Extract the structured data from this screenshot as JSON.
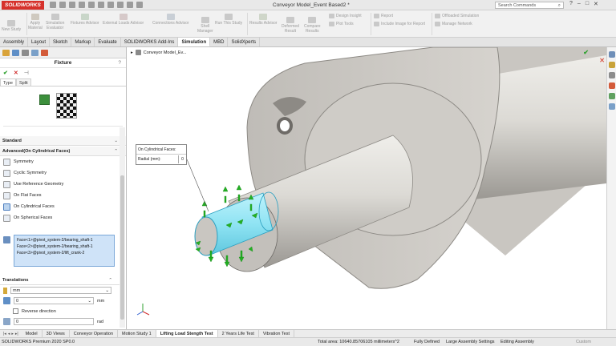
{
  "app": {
    "logo_text": "SOLIDWORKS",
    "doc_title": "Conveyor Model_Event Based2 *"
  },
  "search": {
    "placeholder": "Search Commands"
  },
  "window_controls": [
    "?",
    "–",
    "□",
    "✕"
  ],
  "commands": {
    "new_study": "New Study",
    "apply_material": [
      "Apply",
      "Material"
    ],
    "simulation_evaluator": [
      "Simulation",
      "Evaluator"
    ],
    "fixtures_advisor": "Fixtures Advisor",
    "external_loads_advisor": "External Loads Advisor",
    "connections_advisor": "Connections Advisor",
    "shell_manager": [
      "Shell",
      "Manager"
    ],
    "run_this_study": "Run This Study",
    "results_advisor": "Results Advisor",
    "deformed_result": [
      "Deformed",
      "Result"
    ],
    "compare_results": [
      "Compare",
      "Results"
    ],
    "design_insight": "Design Insight",
    "plot_tools": "Plot Tools",
    "report": "Report",
    "include_image": "Include Image for Report",
    "offloaded_simulation": "Offloaded Simulation",
    "manage_network": "Manage Network"
  },
  "tabs": [
    "Assembly",
    "Layout",
    "Sketch",
    "Markup",
    "Evaluate",
    "SOLIDWORKS Add-Ins",
    "Simulation",
    "MBD",
    "SolidXperts"
  ],
  "active_tab": "Simulation",
  "property_manager": {
    "title": "Fixture",
    "help": "?",
    "subtabs": [
      "Type",
      "Split"
    ],
    "standard_section": "Standard",
    "advanced_section": "Advanced(On Cylindrical Faces)",
    "options": [
      "Symmetry",
      "Cyclic Symmetry",
      "Use Reference Geometry",
      "On Flat Faces",
      "On Cylindrical Faces",
      "On Spherical Faces"
    ],
    "selected_faces": [
      "Face<1>@pivot_system-2/bearing_shaft-1",
      "Face<2>@pivot_system-2/bearing_shaft-1",
      "Face<3>@pivot_system-2/lift_crank-2"
    ],
    "translations_section": "Translations",
    "unit_value": "mm",
    "value_field": "0",
    "value_unit": "mm",
    "reverse_direction": "Reverse direction",
    "angle_value": "0",
    "angle_unit": "rad"
  },
  "viewport": {
    "tree_label": "Conveyor Model_Ev...",
    "callout": {
      "row1": "On Cylindrical Faces:",
      "row2": "Radial (mm):",
      "row2_value": "0"
    }
  },
  "bottom_tabs": [
    "Model",
    "3D Views",
    "Conveyor Operation",
    "Motion Study 1",
    "Lifting Load Stength Test",
    "2 Years Life Test",
    "Vibration Test"
  ],
  "active_bottom_tab": "Lifting Load Stength Test",
  "status_bar": {
    "version": "SOLIDWORKS Premium 2020 SP0.0",
    "total_area": "Total area: 10640.85706105 millimeters^2",
    "defined": "Fully Defined",
    "settings": "Large Assembly Settings",
    "mode": "Editing Assembly",
    "custom": "Custom"
  },
  "colors": {
    "brand_red": "#d6312b",
    "arrow_green": "#23b023",
    "selection_cyan": "#8fe3f3",
    "part_gray": "#d3d0cb"
  }
}
